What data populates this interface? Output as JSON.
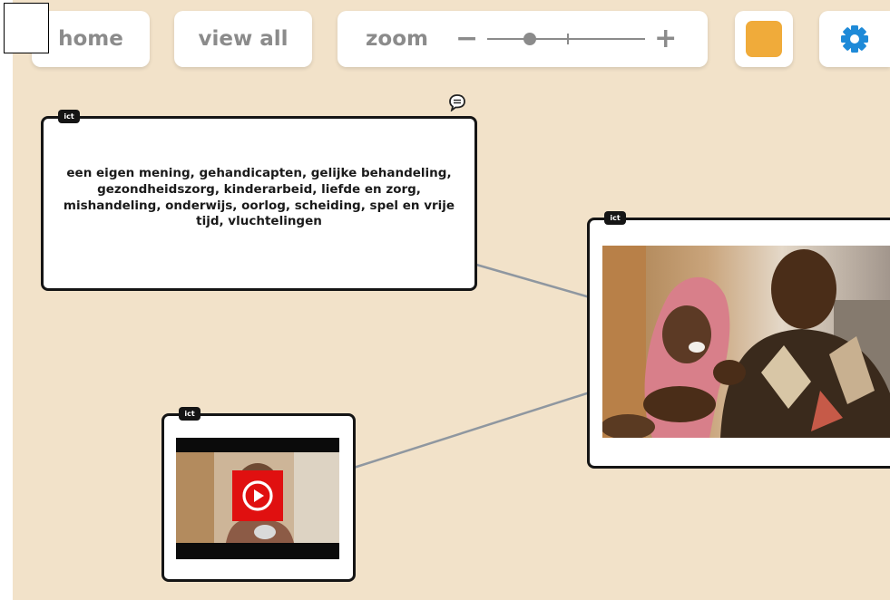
{
  "toolbar": {
    "home_label": "home",
    "view_all_label": "view all",
    "zoom_label": "zoom",
    "zoom_out_symbol": "−",
    "zoom_in_symbol": "+",
    "zoom_level": 0.2,
    "color_swatch": "#f0ab3a",
    "settings_icon": "gear-icon"
  },
  "canvas": {
    "background": "#f2e2c9",
    "line_color": "#8f97a0"
  },
  "cards": {
    "text_card": {
      "tag": "ict",
      "text": "een eigen mening, gehandicapten, gelijke behandeling, gezondheidszorg, kinderarbeid, liefde en zorg, mishandeling, onderwijs, oorlog, scheiding, spel en vrije tijd, vluchtelingen",
      "comment_icon": "speech-bubble-icon"
    },
    "image_card": {
      "tag": "ict",
      "image": "photo of a smiling woman holding a baby in a pink hood"
    },
    "video_card": {
      "tag": "ict",
      "thumbnail": "video thumbnail of a girl speaking",
      "play_icon": "play-icon"
    }
  }
}
